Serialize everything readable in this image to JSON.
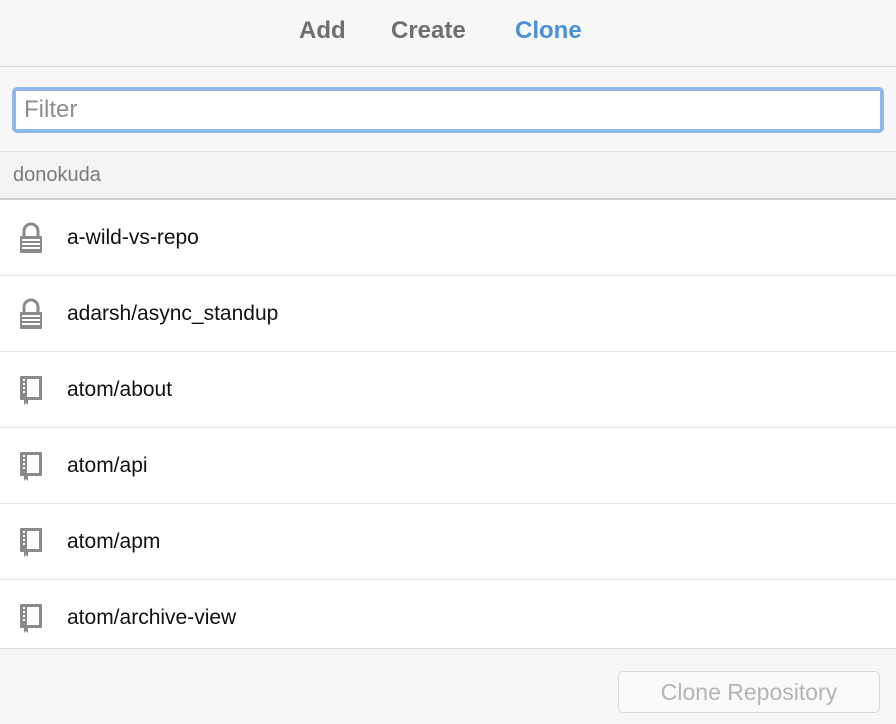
{
  "tabs": {
    "add": "Add",
    "create": "Create",
    "clone": "Clone",
    "active": "clone"
  },
  "filter": {
    "value": "",
    "placeholder": "Filter"
  },
  "group": {
    "label": "donokuda"
  },
  "repos": [
    {
      "name": "a-wild-vs-repo",
      "icon": "lock-icon"
    },
    {
      "name": "adarsh/async_standup",
      "icon": "lock-icon"
    },
    {
      "name": "atom/about",
      "icon": "repo-book-icon"
    },
    {
      "name": "atom/api",
      "icon": "repo-book-icon"
    },
    {
      "name": "atom/apm",
      "icon": "repo-book-icon"
    },
    {
      "name": "atom/archive-view",
      "icon": "repo-book-icon"
    }
  ],
  "footer": {
    "clone_button_label": "Clone Repository",
    "clone_button_enabled": false
  },
  "colors": {
    "accent": "#4a90d6",
    "focus_ring": "#8fb8ea",
    "tab_inactive": "#6f6f6f",
    "disabled_text": "#b4b4b4"
  }
}
